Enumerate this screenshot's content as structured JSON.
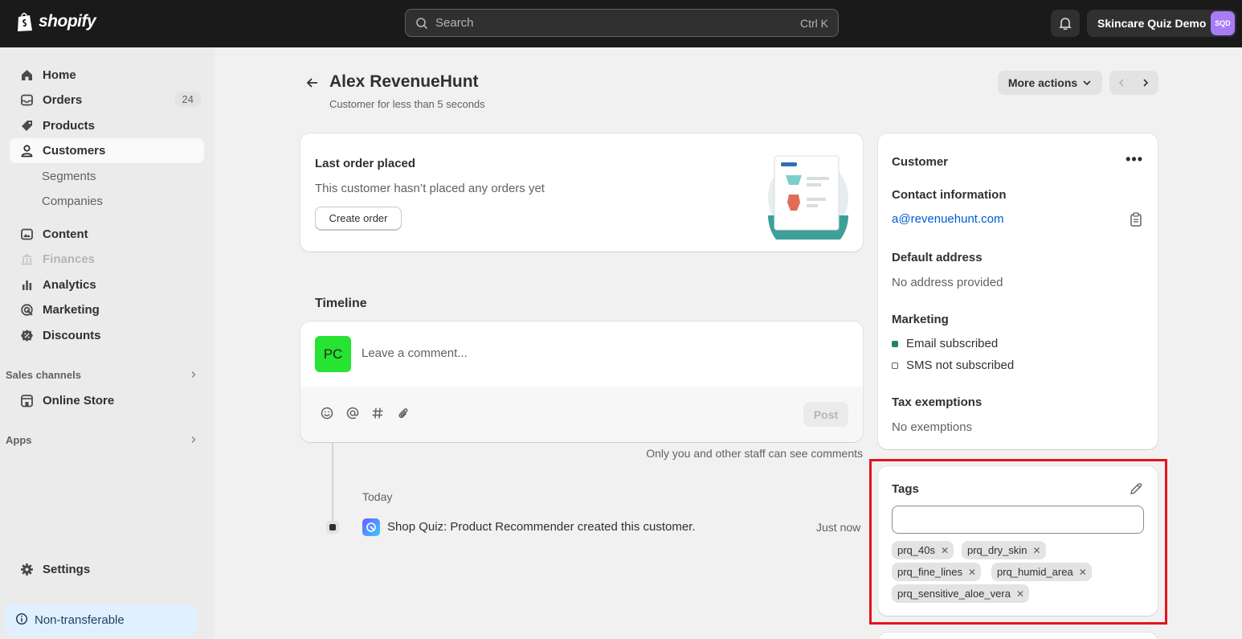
{
  "topbar": {
    "logo_text": "shopify",
    "search_placeholder": "Search",
    "search_shortcut": "Ctrl K",
    "store_name": "Skincare Quiz Demo",
    "store_initials": "SQD"
  },
  "sidebar": {
    "items": [
      {
        "label": "Home",
        "icon": "home-icon"
      },
      {
        "label": "Orders",
        "icon": "orders-icon",
        "badge": "24"
      },
      {
        "label": "Products",
        "icon": "tag-icon"
      },
      {
        "label": "Customers",
        "icon": "person-icon",
        "active": true
      },
      {
        "label": "Segments"
      },
      {
        "label": "Companies"
      },
      {
        "label": "Content",
        "icon": "image-icon"
      },
      {
        "label": "Finances",
        "icon": "bank-icon",
        "disabled": true
      },
      {
        "label": "Analytics",
        "icon": "bar-chart-icon"
      },
      {
        "label": "Marketing",
        "icon": "target-icon"
      },
      {
        "label": "Discounts",
        "icon": "discount-icon"
      },
      {
        "label": "Online Store",
        "icon": "store-icon"
      },
      {
        "label": "Settings",
        "icon": "gear-icon"
      }
    ],
    "sales_channels_label": "Sales channels",
    "apps_label": "Apps",
    "non_transferable_label": "Non-transferable"
  },
  "page": {
    "title": "Alex RevenueHunt",
    "subtitle": "Customer for less than 5 seconds",
    "more_actions_label": "More actions"
  },
  "last_order": {
    "title": "Last order placed",
    "message": "This customer hasn’t placed any orders yet",
    "create_order_label": "Create order"
  },
  "timeline": {
    "title": "Timeline",
    "avatar_initials": "PC",
    "comment_placeholder": "Leave a comment...",
    "post_label": "Post",
    "staff_note": "Only you and other staff can see comments",
    "day_label": "Today",
    "event_text": "Shop Quiz: Product Recommender created this customer.",
    "event_time": "Just now"
  },
  "customer": {
    "title": "Customer",
    "contact_label": "Contact information",
    "email": "a@revenuehunt.com",
    "address_label": "Default address",
    "address_value": "No address provided",
    "marketing_label": "Marketing",
    "email_status": "Email subscribed",
    "sms_status": "SMS not subscribed",
    "tax_label": "Tax exemptions",
    "tax_value": "No exemptions"
  },
  "tags": {
    "title": "Tags",
    "input_value": "",
    "items": [
      "prq_40s",
      "prq_dry_skin",
      "prq_fine_lines",
      "prq_humid_area",
      "prq_sensitive_aloe_vera"
    ]
  },
  "colors": {
    "topbar": "#1a1a1a",
    "link": "#005bd3",
    "subscribed": "#29845a",
    "highlight": "#e3141c",
    "avatar_pc": "#27e332",
    "store_avatar": "#a87cf5"
  }
}
